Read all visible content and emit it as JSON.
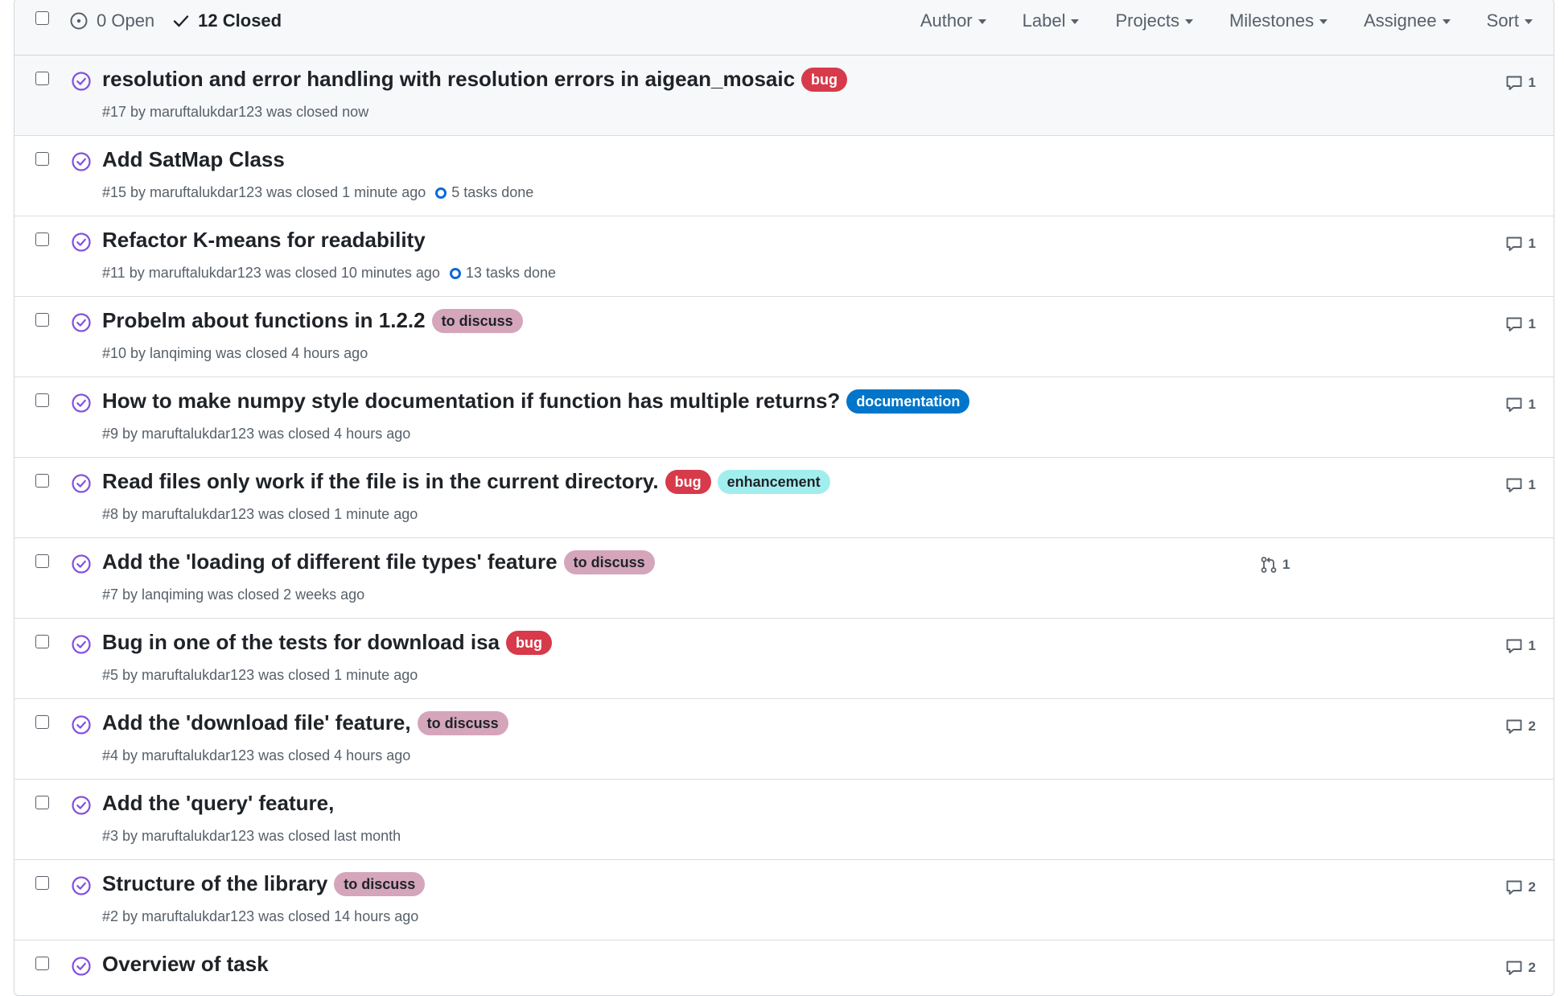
{
  "header": {
    "open_label": "0 Open",
    "closed_label": "12 Closed",
    "filters": [
      "Author",
      "Label",
      "Projects",
      "Milestones",
      "Assignee",
      "Sort"
    ]
  },
  "colors": {
    "bug": "#d73a4a",
    "to_discuss": "#d4a5bb",
    "documentation": "#0075ca",
    "enhancement": "#a2eeef",
    "closed_purple": "#8250df"
  },
  "issues": [
    {
      "title": "resolution and error handling with resolution errors in aigean_mosaic",
      "labels": [
        {
          "text": "bug",
          "kind": "bug"
        }
      ],
      "meta": "#17 by maruftalukdar123 was closed now",
      "tasks": "",
      "comments": "1",
      "linked_prs": ""
    },
    {
      "title": "Add SatMap Class",
      "labels": [],
      "meta": "#15 by maruftalukdar123 was closed 1 minute ago",
      "tasks": "5 tasks done",
      "comments": "",
      "linked_prs": ""
    },
    {
      "title": "Refactor K-means for readability",
      "labels": [],
      "meta": "#11 by maruftalukdar123 was closed 10 minutes ago",
      "tasks": "13 tasks done",
      "comments": "1",
      "linked_prs": ""
    },
    {
      "title": "Probelm about functions in 1.2.2",
      "labels": [
        {
          "text": "to discuss",
          "kind": "to_discuss"
        }
      ],
      "meta": "#10 by lanqiming was closed 4 hours ago",
      "tasks": "",
      "comments": "1",
      "linked_prs": ""
    },
    {
      "title": "How to make numpy style documentation if function has multiple returns?",
      "labels": [
        {
          "text": "documentation",
          "kind": "documentation"
        }
      ],
      "meta": "#9 by maruftalukdar123 was closed 4 hours ago",
      "tasks": "",
      "comments": "1",
      "linked_prs": ""
    },
    {
      "title": "Read files only work if the file is in the current directory.",
      "labels": [
        {
          "text": "bug",
          "kind": "bug"
        },
        {
          "text": "enhancement",
          "kind": "enhancement"
        }
      ],
      "meta": "#8 by maruftalukdar123 was closed 1 minute ago",
      "tasks": "",
      "comments": "1",
      "linked_prs": ""
    },
    {
      "title": "Add the 'loading of different file types' feature",
      "labels": [
        {
          "text": "to discuss",
          "kind": "to_discuss"
        }
      ],
      "meta": "#7 by lanqiming was closed 2 weeks ago",
      "tasks": "",
      "comments": "",
      "linked_prs": "1"
    },
    {
      "title": "Bug in one of the tests for download isa",
      "labels": [
        {
          "text": "bug",
          "kind": "bug"
        }
      ],
      "meta": "#5 by maruftalukdar123 was closed 1 minute ago",
      "tasks": "",
      "comments": "1",
      "linked_prs": ""
    },
    {
      "title": "Add the 'download file' feature,",
      "labels": [
        {
          "text": "to discuss",
          "kind": "to_discuss"
        }
      ],
      "meta": "#4 by maruftalukdar123 was closed 4 hours ago",
      "tasks": "",
      "comments": "2",
      "linked_prs": ""
    },
    {
      "title": "Add the 'query' feature,",
      "labels": [],
      "meta": "#3 by maruftalukdar123 was closed last month",
      "tasks": "",
      "comments": "",
      "linked_prs": ""
    },
    {
      "title": "Structure of the library",
      "labels": [
        {
          "text": "to discuss",
          "kind": "to_discuss"
        }
      ],
      "meta": "#2 by maruftalukdar123 was closed 14 hours ago",
      "tasks": "",
      "comments": "2",
      "linked_prs": ""
    },
    {
      "title": "Overview of task",
      "labels": [],
      "meta": "",
      "tasks": "",
      "comments": "2",
      "linked_prs": ""
    }
  ]
}
